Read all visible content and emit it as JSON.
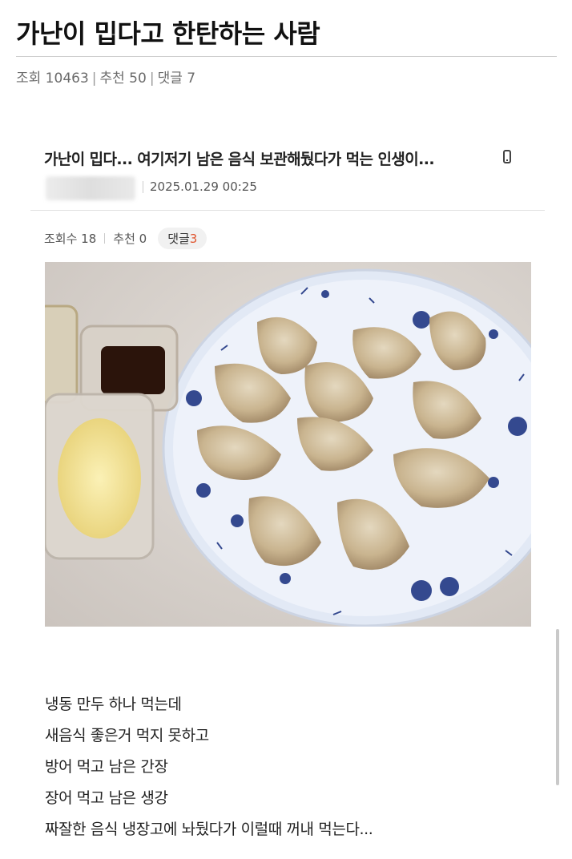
{
  "post": {
    "title": "가난이 밉다고 한탄하는 사람",
    "meta": {
      "views": "조회 10463",
      "recommends": "추천 50",
      "comments": "댓글 7",
      "separator": "|"
    }
  },
  "screenshot": {
    "title": "가난이 밉다... 여기저기 남은 음식 보관해뒀다가 먹는 인생이...",
    "date": "2025.01.29 00:25",
    "stats": {
      "views": "조회수 18",
      "recommends": "추천 0",
      "comment_label": "댓글",
      "comment_count": "3"
    },
    "body_lines": [
      "냉동 만두 하나 먹는데",
      "새음식 좋은거 먹지 못하고",
      "방어 먹고 남은 간장",
      "장어 먹고 남은 생강",
      "짜잘한 음식 냉장고에 놔뒀다가 이럴때 꺼내 먹는다..."
    ]
  }
}
